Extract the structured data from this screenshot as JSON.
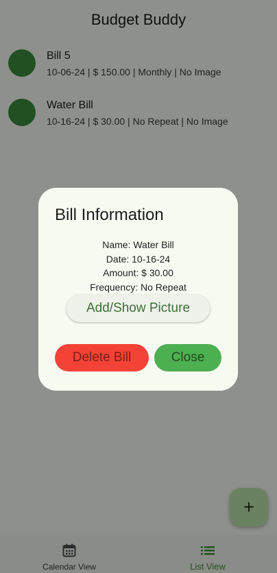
{
  "app_title": "Budget Buddy",
  "bills": [
    {
      "title": "Bill 5",
      "subtitle": "10-06-24 | $ 150.00 | Monthly | No Image"
    },
    {
      "title": "Water Bill",
      "subtitle": "10-16-24 | $ 30.00 | No Repeat | No Image"
    }
  ],
  "fab": {
    "label": "+",
    "icon": "add-icon"
  },
  "bottom_nav": {
    "items": [
      {
        "label": "Calendar View",
        "icon": "calendar-icon",
        "active": false
      },
      {
        "label": "List View",
        "icon": "list-icon",
        "active": true
      }
    ]
  },
  "dialog": {
    "title": "Bill Information",
    "lines": [
      "Name: Water Bill",
      "Date: 10-16-24",
      "Amount: $ 30.00",
      "Frequency: No Repeat"
    ],
    "picture_button": "Add/Show Picture",
    "delete_button": "Delete Bill",
    "close_button": "Close"
  },
  "colors": {
    "avatar": "#3a8b3c",
    "delete": "#f44336",
    "close": "#4caf50",
    "active_nav": "#3e8e3a",
    "fab": "#b9e0a9"
  }
}
